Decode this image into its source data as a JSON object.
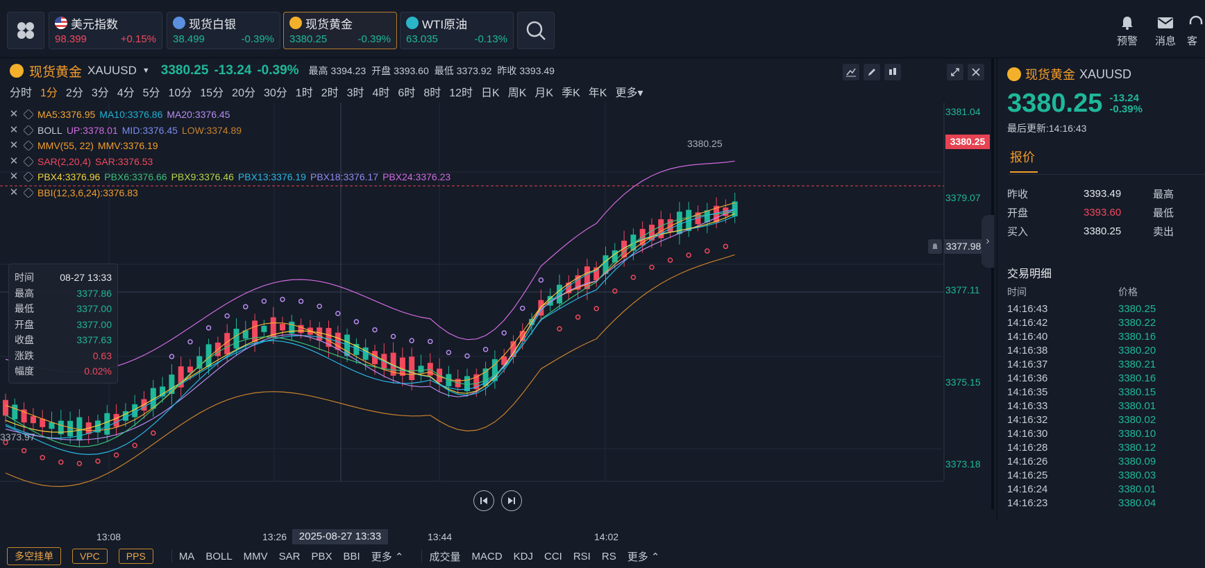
{
  "topbar": {
    "tickers": [
      {
        "name": "美元指数",
        "price": "98.399",
        "change": "+0.15%",
        "dir": "up",
        "icon": "us-flag-icon"
      },
      {
        "name": "现货白银",
        "price": "38.499",
        "change": "-0.39%",
        "dir": "down",
        "icon": "silver-icon"
      },
      {
        "name": "现货黄金",
        "price": "3380.25",
        "change": "-0.39%",
        "dir": "down",
        "icon": "gold-icon"
      },
      {
        "name": "WTI原油",
        "price": "63.035",
        "change": "-0.13%",
        "dir": "down",
        "icon": "oil-icon"
      }
    ],
    "actions": {
      "alert": "预警",
      "message": "消息",
      "service": "客"
    }
  },
  "chart_panel": {
    "symbol_name": "现货黄金",
    "symbol_code": "XAUUSD",
    "price": "3380.25",
    "change": "-13.24",
    "change_pct": "-0.39%",
    "high_label": "最高",
    "high": "3394.23",
    "open_label": "开盘",
    "open": "3393.60",
    "low_label": "最低",
    "low": "3373.92",
    "prev_label": "昨收",
    "prev": "3393.49",
    "periods": [
      "分时",
      "1分",
      "2分",
      "3分",
      "4分",
      "5分",
      "10分",
      "15分",
      "20分",
      "30分",
      "1时",
      "2时",
      "3时",
      "4时",
      "6时",
      "8时",
      "12时",
      "日K",
      "周K",
      "月K",
      "季K",
      "年K",
      "更多"
    ],
    "active_period": "1分",
    "indicators": [
      {
        "parts": [
          {
            "t": "MA5:3376.95",
            "c": "#f3a536"
          },
          {
            "t": "MA10:3376.86",
            "c": "#1fb3d6"
          },
          {
            "t": "MA20:3376.45",
            "c": "#b78cf0"
          }
        ]
      },
      {
        "parts": [
          {
            "t": "BOLL",
            "c": "#c8ccd4"
          },
          {
            "t": "UP:3378.01",
            "c": "#d06be0"
          },
          {
            "t": "MID:3376.45",
            "c": "#7b8cf0"
          },
          {
            "t": "LOW:3374.89",
            "c": "#c9822d"
          }
        ]
      },
      {
        "parts": [
          {
            "t": "MMV(55, 22)",
            "c": "#f49d2c"
          },
          {
            "t": "MMV:3376.19",
            "c": "#f49d2c"
          }
        ]
      },
      {
        "parts": [
          {
            "t": "SAR(2,20,4)",
            "c": "#f2495e"
          },
          {
            "t": "SAR:3376.53",
            "c": "#f2495e"
          }
        ]
      },
      {
        "parts": [
          {
            "t": "PBX4:3376.96",
            "c": "#f2d33a"
          },
          {
            "t": "PBX6:3376.66",
            "c": "#3cc07a"
          },
          {
            "t": "PBX9:3376.46",
            "c": "#b6d84a"
          },
          {
            "t": "PBX13:3376.19",
            "c": "#2bb7e6"
          },
          {
            "t": "PBX18:3376.17",
            "c": "#8e8cf0"
          },
          {
            "t": "PBX24:3376.23",
            "c": "#d06be0"
          }
        ]
      },
      {
        "parts": [
          {
            "t": "BBI(12,3,6,24):3376.83",
            "c": "#f49d2c"
          }
        ]
      }
    ],
    "infobox": [
      {
        "k": "时间",
        "v": "08-27 13:33",
        "c": "#e6e8ec"
      },
      {
        "k": "最高",
        "v": "3377.86",
        "c": "#1fb89a"
      },
      {
        "k": "最低",
        "v": "3377.00",
        "c": "#1fb89a"
      },
      {
        "k": "开盘",
        "v": "3377.00",
        "c": "#1fb89a"
      },
      {
        "k": "收盘",
        "v": "3377.63",
        "c": "#1fb89a"
      },
      {
        "k": "涨跌",
        "v": "0.63",
        "c": "#f2495e"
      },
      {
        "k": "幅度",
        "v": "0.02%",
        "c": "#f2495e"
      }
    ],
    "price_ticks": [
      "3381.04",
      "3379.07",
      "3377.11",
      "3375.15",
      "3373.18"
    ],
    "current_price_tag": "3380.25",
    "crosshair_price_tag": "3377.98",
    "crosshair_time_tag": "2025-08-27 13:33",
    "high_marker": "3380.25",
    "low_marker": "3373.97",
    "time_ticks": [
      "13:08",
      "13:26",
      "13:44",
      "14:02"
    ],
    "bottom_buttons": [
      "多空挂单",
      "VPC",
      "PPS"
    ],
    "main_indicators": [
      "MA",
      "BOLL",
      "MMV",
      "SAR",
      "PBX",
      "BBI",
      "更多"
    ],
    "sub_indicators": [
      "成交量",
      "MACD",
      "KDJ",
      "CCI",
      "RSI",
      "RS",
      "更多"
    ]
  },
  "right_panel": {
    "symbol_name": "现货黄金",
    "symbol_code": "XAUUSD",
    "price": "3380.25",
    "change": "-13.24",
    "change_pct": "-0.39%",
    "updated": "最后更新:14:16:43",
    "tab": "报价",
    "quotes": [
      {
        "k": "昨收",
        "v": "3393.49",
        "c": "#e6e8ec",
        "k2": "最高"
      },
      {
        "k": "开盘",
        "v": "3393.60",
        "c": "#f2495e",
        "k2": "最低"
      },
      {
        "k": "买入",
        "v": "3380.25",
        "c": "#e6e8ec",
        "k2": "卖出"
      }
    ],
    "trades_title": "交易明细",
    "trades_headers": [
      "时间",
      "价格"
    ],
    "trades": [
      [
        "14:16:43",
        "3380.25"
      ],
      [
        "14:16:42",
        "3380.22"
      ],
      [
        "14:16:40",
        "3380.16"
      ],
      [
        "14:16:38",
        "3380.20"
      ],
      [
        "14:16:37",
        "3380.21"
      ],
      [
        "14:16:36",
        "3380.16"
      ],
      [
        "14:16:35",
        "3380.15"
      ],
      [
        "14:16:33",
        "3380.01"
      ],
      [
        "14:16:32",
        "3380.02"
      ],
      [
        "14:16:30",
        "3380.10"
      ],
      [
        "14:16:28",
        "3380.12"
      ],
      [
        "14:16:26",
        "3380.09"
      ],
      [
        "14:16:25",
        "3380.03"
      ],
      [
        "14:16:24",
        "3380.01"
      ],
      [
        "14:16:23",
        "3380.04"
      ]
    ]
  },
  "colors": {
    "up": "#f2495e",
    "down": "#1fb89a",
    "accent": "#f49d2c",
    "bg": "#151b27"
  }
}
